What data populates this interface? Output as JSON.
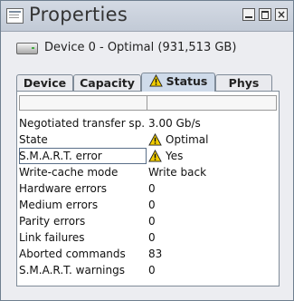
{
  "window": {
    "title": "Properties"
  },
  "device": {
    "title": "Device 0 - Optimal (931,513 GB)"
  },
  "tabs": [
    {
      "label": "Device",
      "active": false
    },
    {
      "label": "Capacity",
      "active": false
    },
    {
      "label": "Status",
      "active": true,
      "icon": "warning-icon"
    },
    {
      "label": "Phys",
      "active": false
    }
  ],
  "status_rows": [
    {
      "key": "Negotiated transfer sp...",
      "value": "3.00 Gb/s"
    },
    {
      "key": "State",
      "value": "Optimal",
      "icon": "warning-icon"
    },
    {
      "key": "S.M.A.R.T. error",
      "value": "Yes",
      "icon": "warning-icon",
      "selected": true
    },
    {
      "key": "Write-cache mode",
      "value": "Write back"
    },
    {
      "key": "Hardware errors",
      "value": "0"
    },
    {
      "key": "Medium errors",
      "value": "0"
    },
    {
      "key": "Parity errors",
      "value": "0"
    },
    {
      "key": "Link failures",
      "value": "0"
    },
    {
      "key": "Aborted commands",
      "value": "83"
    },
    {
      "key": "S.M.A.R.T. warnings",
      "value": "0"
    }
  ],
  "colors": {
    "warning": "#f2cd00",
    "active_tab": "#cfdbea",
    "window_bg": "#ecedf1"
  }
}
